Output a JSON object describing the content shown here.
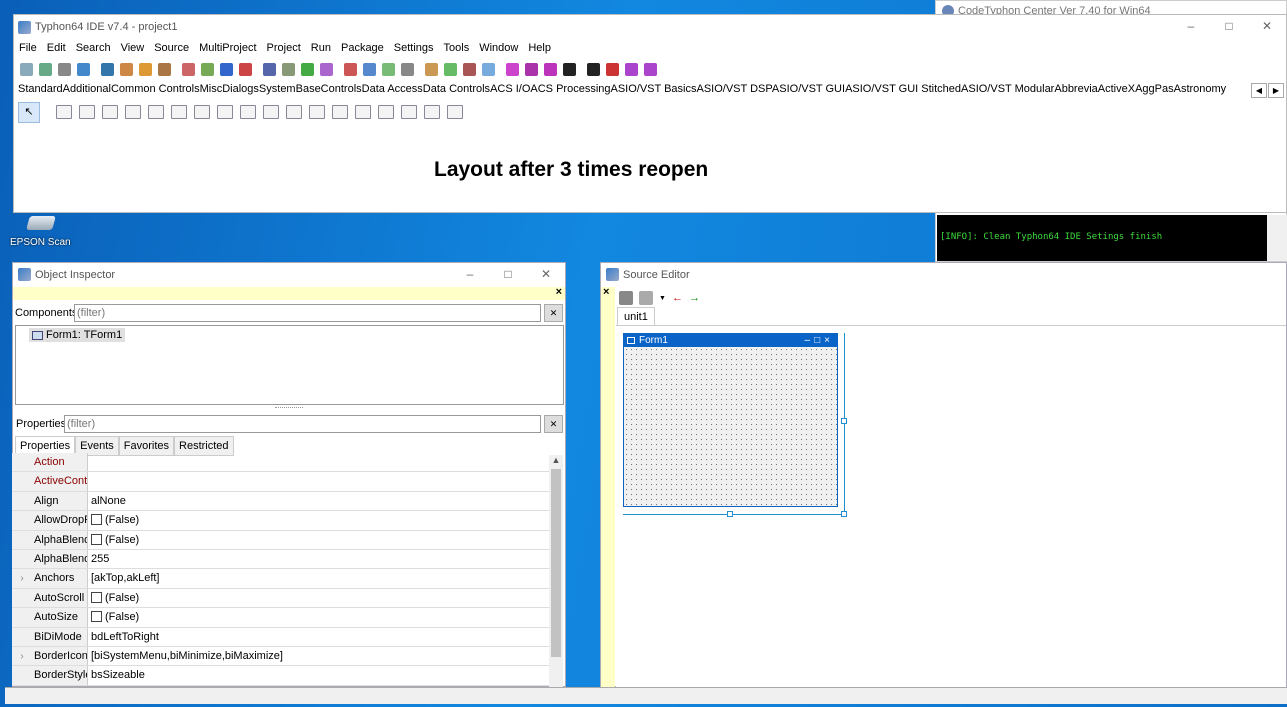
{
  "ide": {
    "title": "Typhon64 IDE v7.4 - project1",
    "menu": [
      "File",
      "Edit",
      "Search",
      "View",
      "Source",
      "MultiProject",
      "Project",
      "Run",
      "Package",
      "Settings",
      "Tools",
      "Window",
      "Help"
    ],
    "palette_tabs": [
      "Standard",
      "Additional",
      "Common Controls",
      "Misc",
      "Dialogs",
      "System",
      "BaseControls",
      "Data Access",
      "Data Controls",
      "ACS I/O",
      "ACS Processing",
      "ASIO/VST Basics",
      "ASIO/VST DSP",
      "ASIO/VST GUI",
      "ASIO/VST GUI Stitched",
      "ASIO/VST Modular",
      "Abbrevia",
      "ActiveX",
      "AggPas",
      "Astronomy"
    ],
    "caption": "Layout after 3 times reopen"
  },
  "center": {
    "title": "CodeTyphon Center Ver 7.40 for Win64"
  },
  "desktop": {
    "epson_label": "EPSON Scan"
  },
  "console": {
    "text": "[INFO]: Clean Typhon64 IDE Setings finish"
  },
  "inspector": {
    "title": "Object Inspector",
    "components_label": "Components",
    "filter_placeholder": "(filter)",
    "tree_item": "Form1: TForm1",
    "properties_label": "Properties",
    "tabs": [
      "Properties",
      "Events",
      "Favorites",
      "Restricted"
    ],
    "rows": [
      {
        "name": "Action",
        "value": "",
        "red": true,
        "expand": false,
        "check": false
      },
      {
        "name": "ActiveControl",
        "value": "",
        "red": true,
        "expand": false,
        "check": false
      },
      {
        "name": "Align",
        "value": "alNone",
        "red": false,
        "expand": false,
        "check": false
      },
      {
        "name": "AllowDropFiles",
        "value": "(False)",
        "red": false,
        "expand": false,
        "check": true
      },
      {
        "name": "AlphaBlend",
        "value": "(False)",
        "red": false,
        "expand": false,
        "check": true
      },
      {
        "name": "AlphaBlendValue",
        "value": "255",
        "red": false,
        "expand": false,
        "check": false
      },
      {
        "name": "Anchors",
        "value": "[akTop,akLeft]",
        "red": false,
        "expand": true,
        "check": false
      },
      {
        "name": "AutoScroll",
        "value": "(False)",
        "red": false,
        "expand": false,
        "check": true
      },
      {
        "name": "AutoSize",
        "value": "(False)",
        "red": false,
        "expand": false,
        "check": true
      },
      {
        "name": "BiDiMode",
        "value": "bdLeftToRight",
        "red": false,
        "expand": false,
        "check": false
      },
      {
        "name": "BorderIcons",
        "value": "[biSystemMenu,biMinimize,biMaximize]",
        "red": false,
        "expand": true,
        "check": false
      },
      {
        "name": "BorderStyle",
        "value": "bsSizeable",
        "red": false,
        "expand": false,
        "check": false
      }
    ]
  },
  "editor": {
    "title": "Source Editor",
    "tab": "unit1",
    "form_title": "Form1"
  },
  "colors": {
    "red_prop": "#8b0000",
    "console_text": "#3ddc3d",
    "selection": "#0a64c8"
  }
}
